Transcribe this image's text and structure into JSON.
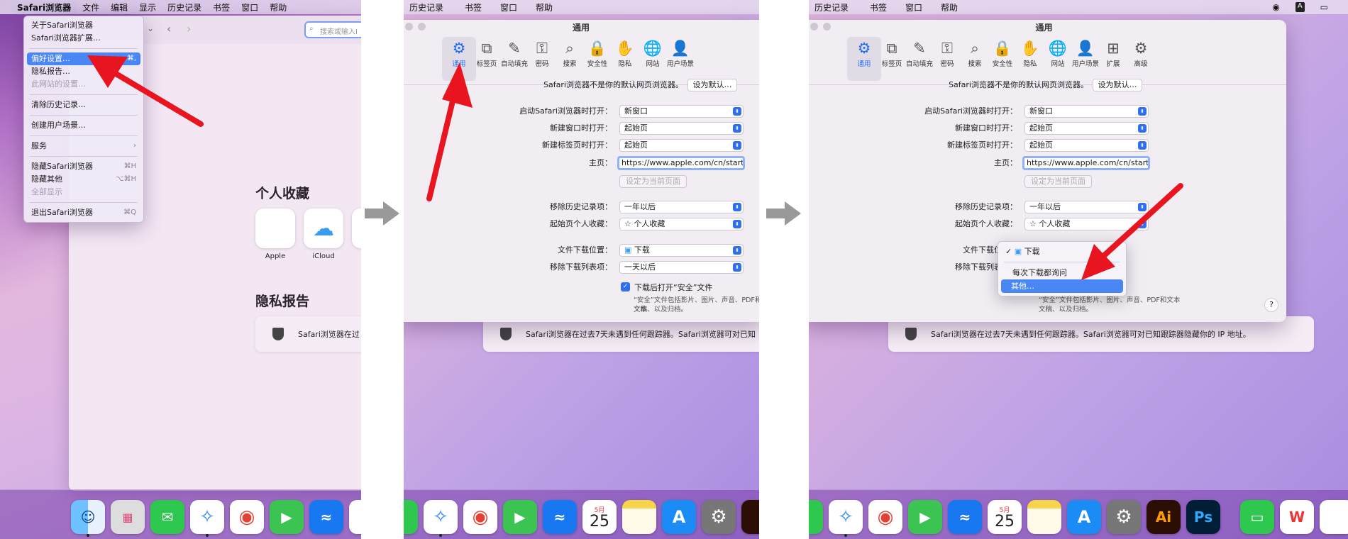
{
  "panel1": {
    "menubar": {
      "items": [
        "Safari浏览器",
        "文件",
        "编辑",
        "显示",
        "历史记录",
        "书签",
        "窗口",
        "帮助"
      ]
    },
    "search_placeholder": "搜索或输入I",
    "menu": [
      {
        "label": "关于Safari浏览器",
        "shortcut": "",
        "state": "normal"
      },
      {
        "label": "Safari浏览器扩展…",
        "shortcut": "",
        "state": "normal"
      },
      {
        "sep": true
      },
      {
        "label": "偏好设置…",
        "shortcut": "⌘,",
        "state": "selected"
      },
      {
        "label": "隐私报告…",
        "shortcut": "",
        "state": "normal"
      },
      {
        "label": "此网站的设置…",
        "shortcut": "",
        "state": "disabled"
      },
      {
        "sep": true
      },
      {
        "label": "清除历史记录…",
        "shortcut": "",
        "state": "normal"
      },
      {
        "sep": true
      },
      {
        "label": "创建用户场景…",
        "shortcut": "",
        "state": "normal"
      },
      {
        "sep": true
      },
      {
        "label": "服务",
        "shortcut": "›",
        "state": "normal"
      },
      {
        "sep": true
      },
      {
        "label": "隐藏Safari浏览器",
        "shortcut": "⌘H",
        "state": "normal"
      },
      {
        "label": "隐藏其他",
        "shortcut": "⌥⌘H",
        "state": "normal"
      },
      {
        "label": "全部显示",
        "shortcut": "",
        "state": "disabled"
      },
      {
        "sep": true
      },
      {
        "label": "退出Safari浏览器",
        "shortcut": "⌘Q",
        "state": "normal"
      }
    ],
    "favorites_title": "个人收藏",
    "favorites": [
      {
        "label": "Apple",
        "icon": "apple-icon"
      },
      {
        "label": "iCloud",
        "icon": "cloud-icon"
      }
    ],
    "privacy_title": "隐私报告",
    "privacy_text": "Safari浏览器在过"
  },
  "menubar_partial": {
    "items": [
      "历史记录",
      "书签",
      "窗口",
      "帮助"
    ]
  },
  "prefs": {
    "title": "通用",
    "tabs_short": [
      "通用",
      "标签页",
      "自动填充",
      "密码",
      "搜索",
      "安全性",
      "隐私",
      "网站",
      "用户场景"
    ],
    "tabs_full": [
      "通用",
      "标签页",
      "自动填充",
      "密码",
      "搜索",
      "安全性",
      "隐私",
      "网站",
      "用户场景",
      "扩展",
      "高级"
    ],
    "tab_icons": [
      "⚙",
      "⧉",
      "✎",
      "⚿",
      "⌕",
      "🔒",
      "✋",
      "🌐",
      "👤",
      "⊞",
      "⚙"
    ],
    "default_text": "Safari浏览器不是你的默认网页浏览器。",
    "set_default": "设为默认…",
    "rows": {
      "open_with_label": "启动Safari浏览器时打开：",
      "open_with": "新窗口",
      "new_window_label": "新建窗口时打开：",
      "new_window": "起始页",
      "new_tab_label": "新建标签页时打开：",
      "new_tab": "起始页",
      "homepage_label": "主页：",
      "homepage": "https://www.apple.com/cn/startpa",
      "set_current": "设定为当前页面",
      "remove_history_label": "移除历史记录项：",
      "remove_history": "一年以后",
      "favorites_label": "起始页个人收藏：",
      "favorites": "☆ 个人收藏",
      "download_loc_label": "文件下载位置：",
      "download_loc": "下载",
      "remove_dl_label": "移除下载列表项：",
      "remove_dl": "一天以后",
      "open_safe_label": "下载后打开“安全”文件",
      "safe_note_1": "“安全”文件包括影片、图片、声音、PDF和文本",
      "safe_note_2": "文稿、以及归档。"
    },
    "popup": [
      "下载",
      "每次下载都询问",
      "其他…"
    ],
    "help": "?"
  },
  "privacy_long": "Safari浏览器在过去7天未遇到任何跟踪器。Safari浏览器可对已知跟踪器隐藏你的 IP 地址。",
  "privacy_mid": "Safari浏览器在过去7天未遇到任何跟踪器。Safari浏览器可对已知",
  "calendar": {
    "month": "5月",
    "day": "25"
  },
  "dock_labels": {
    "ai": "Ai",
    "ps": "Ps"
  },
  "colors": {
    "accent": "#2f6ff0",
    "arrow": "#e8141f",
    "selected": "#4a87f5"
  }
}
